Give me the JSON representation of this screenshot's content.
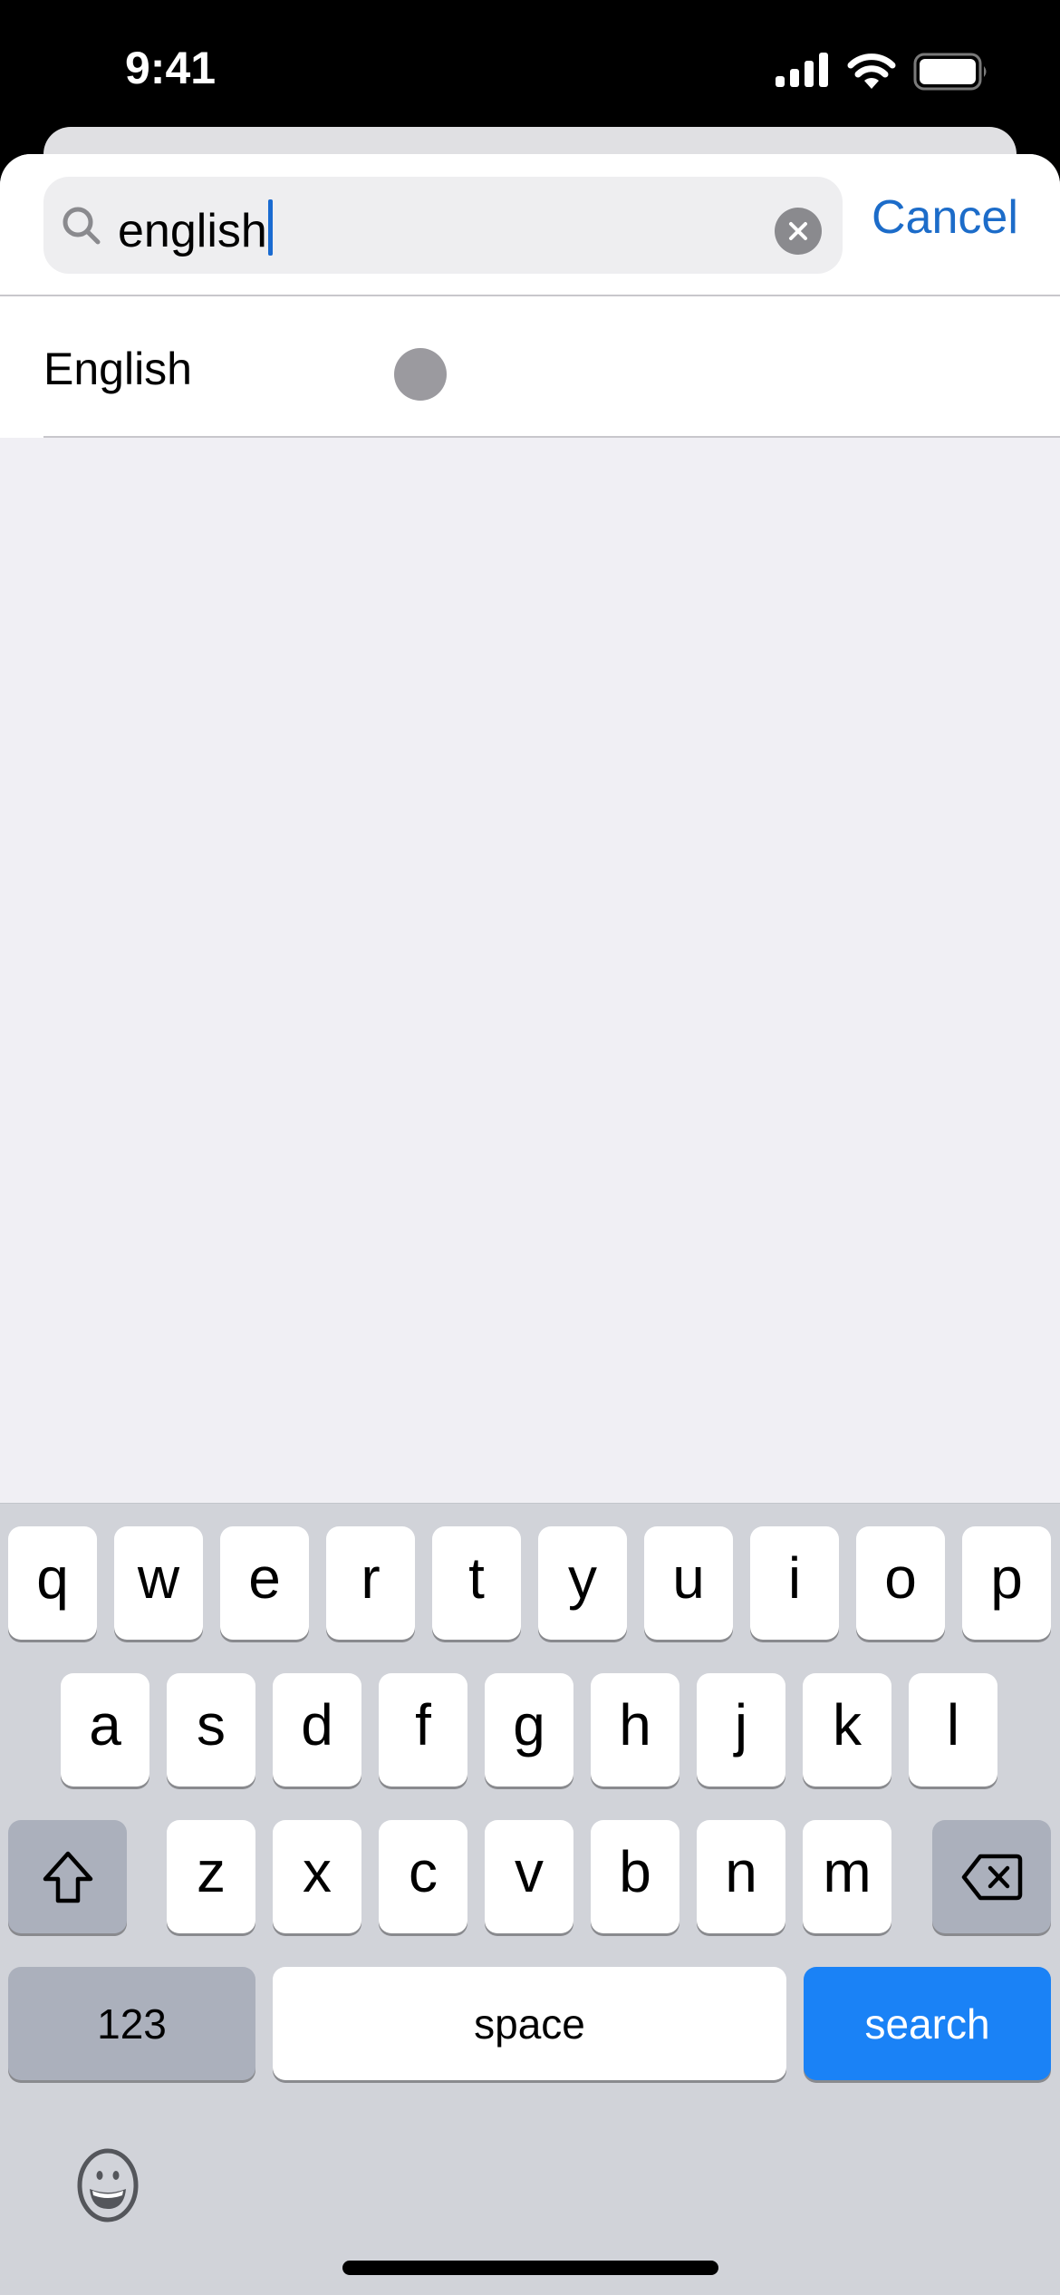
{
  "status_bar": {
    "time": "9:41",
    "icons": [
      "cellular-signal-icon",
      "wifi-icon",
      "battery-icon"
    ]
  },
  "search": {
    "query": "english",
    "icon": "magnifying-glass-icon",
    "clear_icon": "clear-x-icon",
    "cancel_label": "Cancel"
  },
  "results": [
    {
      "label": "English"
    }
  ],
  "keyboard": {
    "row1": [
      "q",
      "w",
      "e",
      "r",
      "t",
      "y",
      "u",
      "i",
      "o",
      "p"
    ],
    "row2": [
      "a",
      "s",
      "d",
      "f",
      "g",
      "h",
      "j",
      "k",
      "l"
    ],
    "row3": [
      "z",
      "x",
      "c",
      "v",
      "b",
      "n",
      "m"
    ],
    "shift_icon": "shift-arrow-icon",
    "delete_icon": "backspace-icon",
    "numbers_label": "123",
    "space_label": "space",
    "return_label": "search",
    "emoji_icon": "emoji-smiley-icon"
  },
  "colors": {
    "accent": "#1c6cc9",
    "search_key": "#1a82f6",
    "keyboard_bg": "#d1d3d9",
    "list_bg": "#f0eff4"
  }
}
